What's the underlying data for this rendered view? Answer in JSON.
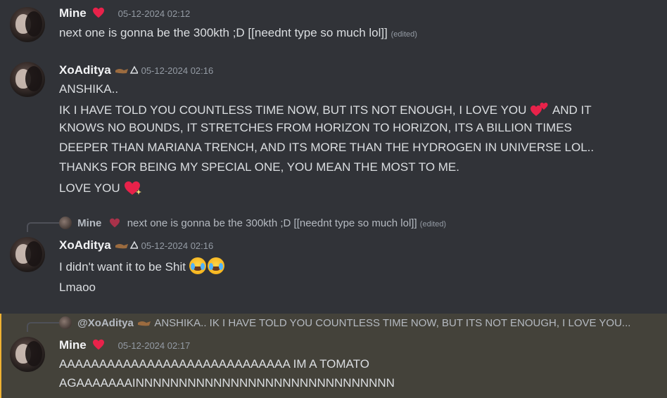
{
  "messages": [
    {
      "author": "Mine",
      "timestamp": "05-12-2024 02:12",
      "lines": [
        "next one is gonna be the 300kth ;D [[neednt type so much lol]]"
      ],
      "edited": "(edited)"
    },
    {
      "author": "XoAditya",
      "timestamp": "05-12-2024 02:16",
      "lines": [
        "ANSHIKA..",
        "IK I HAVE TOLD YOU COUNTLESS TIME NOW, BUT ITS NOT ENOUGH, I LOVE YOU",
        "AND IT",
        "KNOWS NO BOUNDS, IT STRETCHES FROM HORIZON TO HORIZON, ITS A BILLION TIMES",
        "DEEPER THAN MARIANA TRENCH, AND ITS MORE THAN THE HYDROGEN IN UNIVERSE LOL..",
        "THANKS FOR BEING MY SPECIAL ONE, YOU MEAN THE MOST TO ME.",
        "LOVE YOU"
      ]
    },
    {
      "reply_to": {
        "author": "Mine",
        "text": "next one is gonna be the 300kth ;D [[neednt type so much lol]]",
        "edited": "(edited)"
      },
      "author": "XoAditya",
      "timestamp": "05-12-2024 02:16",
      "lines": [
        "I didn't want it to be Shit",
        "Lmaoo"
      ]
    },
    {
      "reply_to": {
        "author": "@XoAditya",
        "text": "ANSHIKA.. IK I HAVE TOLD YOU COUNTLESS TIME NOW, BUT ITS NOT ENOUGH, I LOVE YOU..."
      },
      "author": "Mine",
      "timestamp": "05-12-2024 02:17",
      "lines": [
        "AAAAAAAAAAAAAAAAAAAAAAAAAAAAA IM A TOMATO",
        "AGAAAAAAAINNNNNNNNNNNNNNNNNNNNNNNNNNNNNN"
      ],
      "highlighted": true
    }
  ],
  "colors": {
    "background": "#313338",
    "highlight_background": "#44423a",
    "highlight_accent": "#f0b232",
    "heart": "#e8224a"
  },
  "icons": [
    "heart-emoji",
    "two-hearts-emoji",
    "sparkling-heart-emoji",
    "joy-emoji",
    "user-badge-icon"
  ]
}
